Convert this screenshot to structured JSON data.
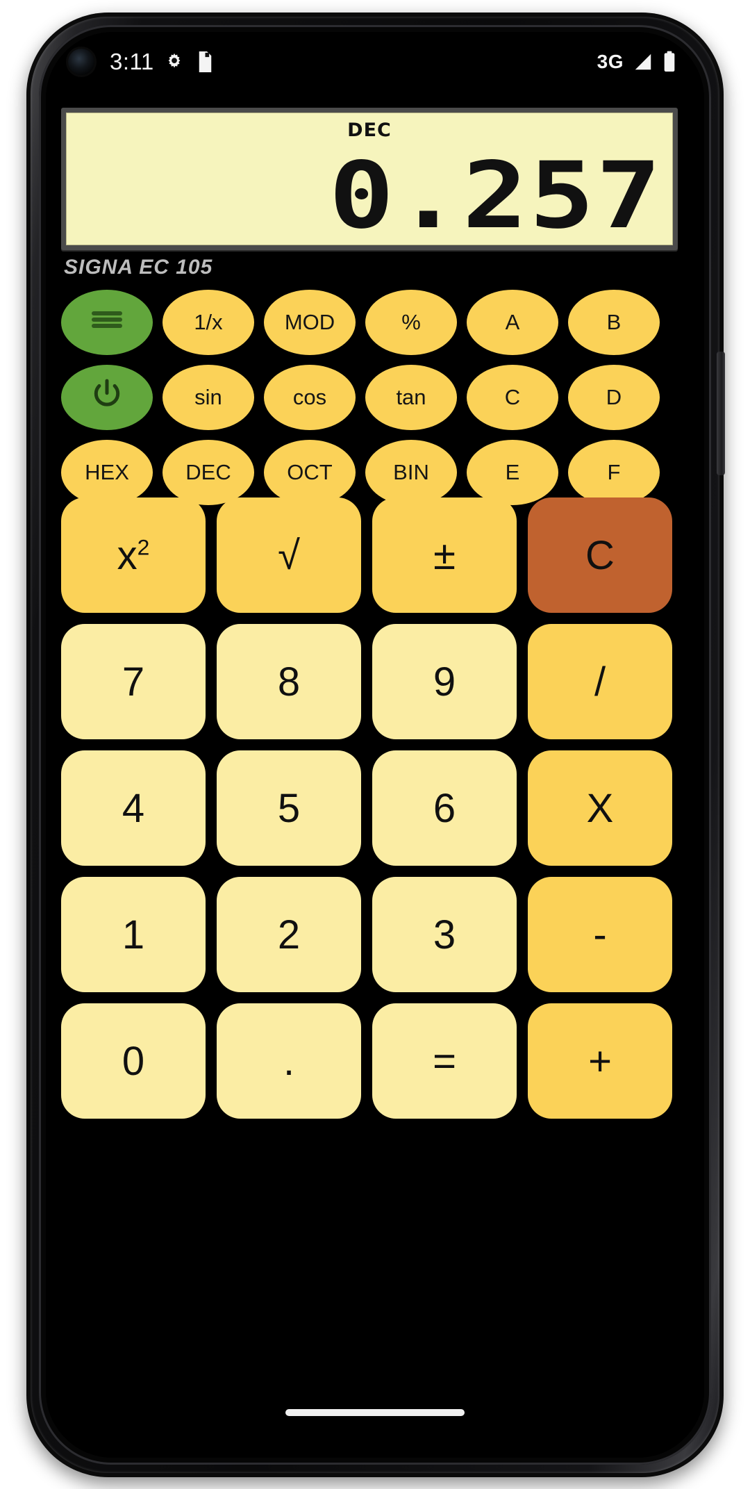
{
  "status_bar": {
    "time": "3:11",
    "icons_left": [
      "camera-punch-hole",
      "gear-icon",
      "sd-card-icon"
    ],
    "network_label": "3G",
    "icons_right": [
      "signal-icon",
      "battery-icon"
    ]
  },
  "display": {
    "mode_label": "DEC",
    "value": "0.257",
    "lcd_background": "#F6F4BD",
    "lcd_text_color": "#111111"
  },
  "brand": {
    "label": "SIGNA EC 105"
  },
  "colors": {
    "gold": "#FBD258",
    "pale_yellow": "#FBEDA4",
    "green": "#62A63C",
    "clear_orange": "#C0622F",
    "body_black": "#000000"
  },
  "function_rows": [
    {
      "keys": [
        {
          "label": "",
          "name": "menu-button",
          "icon": "hamburger-menu-icon",
          "style": "green"
        },
        {
          "label": "1/x",
          "name": "reciprocal-button",
          "style": "gold"
        },
        {
          "label": "MOD",
          "name": "mod-button",
          "style": "gold"
        },
        {
          "label": "%",
          "name": "percent-button",
          "style": "gold"
        },
        {
          "label": "A",
          "name": "hex-a-button",
          "style": "gold"
        },
        {
          "label": "B",
          "name": "hex-b-button",
          "style": "gold"
        }
      ]
    },
    {
      "keys": [
        {
          "label": "",
          "name": "power-button",
          "icon": "power-icon",
          "style": "green"
        },
        {
          "label": "sin",
          "name": "sin-button",
          "style": "gold"
        },
        {
          "label": "cos",
          "name": "cos-button",
          "style": "gold"
        },
        {
          "label": "tan",
          "name": "tan-button",
          "style": "gold"
        },
        {
          "label": "C",
          "name": "hex-c-button",
          "style": "gold"
        },
        {
          "label": "D",
          "name": "hex-d-button",
          "style": "gold"
        }
      ]
    },
    {
      "keys": [
        {
          "label": "HEX",
          "name": "hex-mode-button",
          "style": "gold"
        },
        {
          "label": "DEC",
          "name": "dec-mode-button",
          "style": "gold"
        },
        {
          "label": "OCT",
          "name": "oct-mode-button",
          "style": "gold"
        },
        {
          "label": "BIN",
          "name": "bin-mode-button",
          "style": "gold"
        },
        {
          "label": "E",
          "name": "hex-e-button",
          "style": "gold"
        },
        {
          "label": "F",
          "name": "hex-f-button",
          "style": "gold"
        }
      ]
    }
  ],
  "keypad_rows": [
    {
      "keys": [
        {
          "label": "x²",
          "name": "square-button",
          "style": "op"
        },
        {
          "label": "√",
          "name": "sqrt-button",
          "style": "op"
        },
        {
          "label": "±",
          "name": "sign-toggle-button",
          "style": "op"
        },
        {
          "label": "C",
          "name": "clear-button",
          "style": "clear"
        }
      ]
    },
    {
      "keys": [
        {
          "label": "7",
          "name": "digit-7-button",
          "style": "num"
        },
        {
          "label": "8",
          "name": "digit-8-button",
          "style": "num"
        },
        {
          "label": "9",
          "name": "digit-9-button",
          "style": "num"
        },
        {
          "label": "/",
          "name": "divide-button",
          "style": "op"
        }
      ]
    },
    {
      "keys": [
        {
          "label": "4",
          "name": "digit-4-button",
          "style": "num"
        },
        {
          "label": "5",
          "name": "digit-5-button",
          "style": "num"
        },
        {
          "label": "6",
          "name": "digit-6-button",
          "style": "num"
        },
        {
          "label": "X",
          "name": "multiply-button",
          "style": "op"
        }
      ]
    },
    {
      "keys": [
        {
          "label": "1",
          "name": "digit-1-button",
          "style": "num"
        },
        {
          "label": "2",
          "name": "digit-2-button",
          "style": "num"
        },
        {
          "label": "3",
          "name": "digit-3-button",
          "style": "num"
        },
        {
          "label": "-",
          "name": "subtract-button",
          "style": "op"
        }
      ]
    },
    {
      "keys": [
        {
          "label": "0",
          "name": "digit-0-button",
          "style": "num"
        },
        {
          "label": ".",
          "name": "decimal-point-button",
          "style": "num"
        },
        {
          "label": "=",
          "name": "equals-button",
          "style": "num"
        },
        {
          "label": "+",
          "name": "add-button",
          "style": "op"
        }
      ]
    }
  ]
}
